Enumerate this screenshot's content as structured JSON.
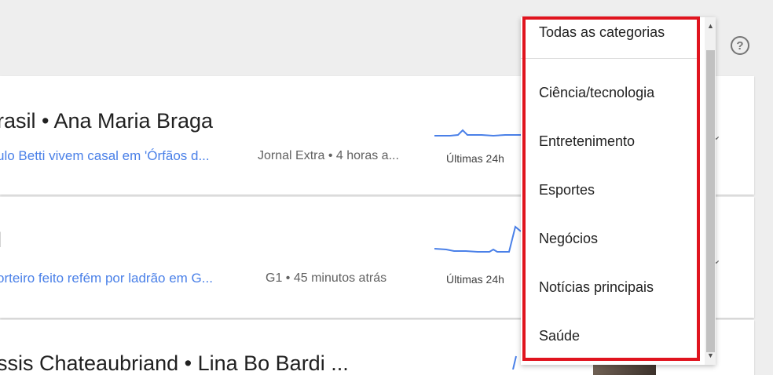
{
  "colors": {
    "highlight_border": "#e0141e",
    "link": "#4a80e8",
    "sparkline": "#4a80e8"
  },
  "cards": [
    {
      "title": "rasil • Ana Maria Braga",
      "link": "ulo Betti vivem casal em 'Órfãos d...",
      "source": "Jornal Extra • 4 horas a...",
      "period": "Últimas 24h"
    },
    {
      "title": "l",
      "link": "orteiro feito refém por ladrão em G...",
      "source": "G1 • 45 minutos atrás",
      "period": "Últimas 24h"
    },
    {
      "title": "ssis Chateaubriand • Lina Bo Bardi ..."
    }
  ],
  "help_icon_glyph": "?",
  "category_dropdown": {
    "selected": "Todas as categorias",
    "options": [
      "Ciência/tecnologia",
      "Entretenimento",
      "Esportes",
      "Negócios",
      "Notícias principais",
      "Saúde"
    ],
    "scroll_up": "▲",
    "scroll_down": "▼"
  }
}
